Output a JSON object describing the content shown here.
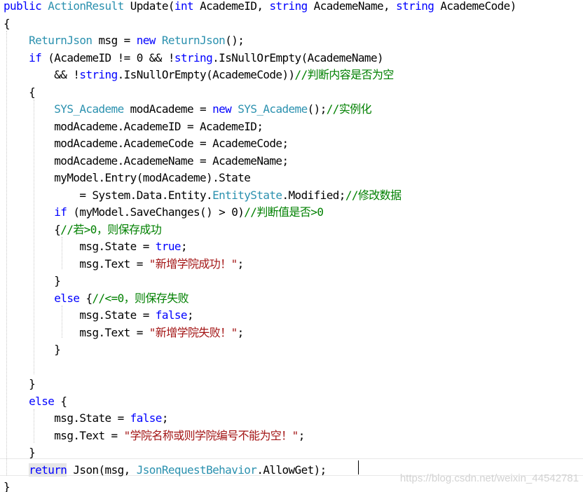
{
  "colors": {
    "keyword": "#0000ff",
    "type": "#2b91af",
    "comment": "#008000",
    "string": "#a31515",
    "plain": "#000000",
    "background": "#ffffff",
    "watermark": "#d2d2d2"
  },
  "watermark": "https://blog.csdn.net/weixin_44542781",
  "code": [
    [
      {
        "k": "kw",
        "t": "public"
      },
      {
        "k": "pl",
        "t": " "
      },
      {
        "k": "ty",
        "t": "ActionResult"
      },
      {
        "k": "pl",
        "t": " Update("
      },
      {
        "k": "kw",
        "t": "int"
      },
      {
        "k": "pl",
        "t": " AcademeID, "
      },
      {
        "k": "kw",
        "t": "string"
      },
      {
        "k": "pl",
        "t": " AcademeName, "
      },
      {
        "k": "kw",
        "t": "string"
      },
      {
        "k": "pl",
        "t": " AcademeCode)"
      }
    ],
    [
      {
        "k": "pl",
        "t": "{"
      }
    ],
    [
      {
        "k": "pl",
        "t": "    "
      },
      {
        "k": "ty",
        "t": "ReturnJson"
      },
      {
        "k": "pl",
        "t": " msg = "
      },
      {
        "k": "kw",
        "t": "new"
      },
      {
        "k": "pl",
        "t": " "
      },
      {
        "k": "ty",
        "t": "ReturnJson"
      },
      {
        "k": "pl",
        "t": "();"
      }
    ],
    [
      {
        "k": "pl",
        "t": "    "
      },
      {
        "k": "kw",
        "t": "if"
      },
      {
        "k": "pl",
        "t": " (AcademeID != 0 && !"
      },
      {
        "k": "kw",
        "t": "string"
      },
      {
        "k": "pl",
        "t": ".IsNullOrEmpty(AcademeName)"
      }
    ],
    [
      {
        "k": "pl",
        "t": "        && !"
      },
      {
        "k": "kw",
        "t": "string"
      },
      {
        "k": "pl",
        "t": ".IsNullOrEmpty(AcademeCode))"
      },
      {
        "k": "cm",
        "t": "//判断内容是否为空"
      }
    ],
    [
      {
        "k": "pl",
        "t": "    {"
      }
    ],
    [
      {
        "k": "pl",
        "t": "        "
      },
      {
        "k": "ty",
        "t": "SYS_Academe"
      },
      {
        "k": "pl",
        "t": " modAcademe = "
      },
      {
        "k": "kw",
        "t": "new"
      },
      {
        "k": "pl",
        "t": " "
      },
      {
        "k": "ty",
        "t": "SYS_Academe"
      },
      {
        "k": "pl",
        "t": "();"
      },
      {
        "k": "cm",
        "t": "//实例化"
      }
    ],
    [
      {
        "k": "pl",
        "t": "        modAcademe.AcademeID = AcademeID;"
      }
    ],
    [
      {
        "k": "pl",
        "t": "        modAcademe.AcademeCode = AcademeCode;"
      }
    ],
    [
      {
        "k": "pl",
        "t": "        modAcademe.AcademeName = AcademeName;"
      }
    ],
    [
      {
        "k": "pl",
        "t": "        myModel.Entry(modAcademe).State"
      }
    ],
    [
      {
        "k": "pl",
        "t": "            = System.Data.Entity."
      },
      {
        "k": "ty",
        "t": "EntityState"
      },
      {
        "k": "pl",
        "t": ".Modified;"
      },
      {
        "k": "cm",
        "t": "//修改数据"
      }
    ],
    [
      {
        "k": "pl",
        "t": "        "
      },
      {
        "k": "kw",
        "t": "if"
      },
      {
        "k": "pl",
        "t": " (myModel.SaveChanges() > 0)"
      },
      {
        "k": "cm",
        "t": "//判断值是否>0"
      }
    ],
    [
      {
        "k": "pl",
        "t": "        {"
      },
      {
        "k": "cm",
        "t": "//若>0，则保存成功"
      }
    ],
    [
      {
        "k": "pl",
        "t": "            msg.State = "
      },
      {
        "k": "kw",
        "t": "true"
      },
      {
        "k": "pl",
        "t": ";"
      }
    ],
    [
      {
        "k": "pl",
        "t": "            msg.Text = "
      },
      {
        "k": "st",
        "t": "\"新增学院成功！\""
      },
      {
        "k": "pl",
        "t": ";"
      }
    ],
    [
      {
        "k": "pl",
        "t": "        }"
      }
    ],
    [
      {
        "k": "pl",
        "t": "        "
      },
      {
        "k": "kw",
        "t": "else"
      },
      {
        "k": "pl",
        "t": " {"
      },
      {
        "k": "cm",
        "t": "//<=0，则保存失败"
      }
    ],
    [
      {
        "k": "pl",
        "t": "            msg.State = "
      },
      {
        "k": "kw",
        "t": "false"
      },
      {
        "k": "pl",
        "t": ";"
      }
    ],
    [
      {
        "k": "pl",
        "t": "            msg.Text = "
      },
      {
        "k": "st",
        "t": "\"新增学院失败！\""
      },
      {
        "k": "pl",
        "t": ";"
      }
    ],
    [
      {
        "k": "pl",
        "t": "        }"
      }
    ],
    [
      {
        "k": "pl",
        "t": ""
      }
    ],
    [
      {
        "k": "pl",
        "t": "    }"
      }
    ],
    [
      {
        "k": "pl",
        "t": "    "
      },
      {
        "k": "kw",
        "t": "else"
      },
      {
        "k": "pl",
        "t": " {"
      }
    ],
    [
      {
        "k": "pl",
        "t": "        msg.State = "
      },
      {
        "k": "kw",
        "t": "false"
      },
      {
        "k": "pl",
        "t": ";"
      }
    ],
    [
      {
        "k": "pl",
        "t": "        msg.Text = "
      },
      {
        "k": "st",
        "t": "\"学院名称或则学院编号不能为空！\""
      },
      {
        "k": "pl",
        "t": ";"
      }
    ],
    [
      {
        "k": "pl",
        "t": "    }"
      }
    ],
    [
      {
        "k": "pl",
        "t": "    "
      },
      {
        "k": "kw",
        "t": "return"
      },
      {
        "k": "pl",
        "t": " Json(msg, "
      },
      {
        "k": "ty",
        "t": "JsonRequestBehavior"
      },
      {
        "k": "pl",
        "t": ".AllowGet);"
      }
    ],
    [
      {
        "k": "pl",
        "t": "}"
      }
    ]
  ]
}
